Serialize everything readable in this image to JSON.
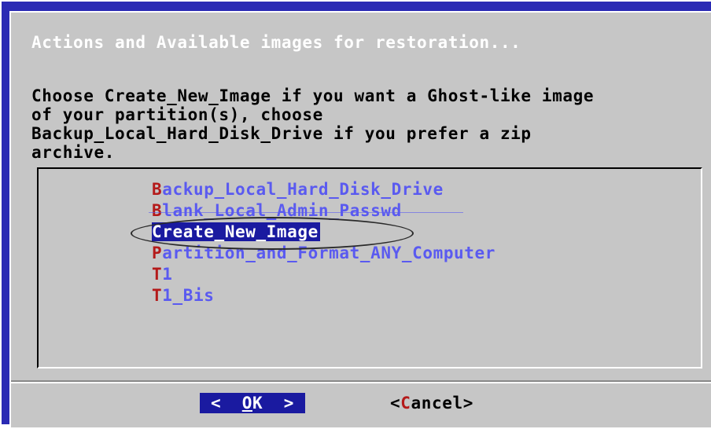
{
  "dialog": {
    "title": "Actions and Available images for restoration...",
    "message_lines": [
      "Choose Create_New_Image if you want a Ghost-like image",
      "of your partition(s), choose",
      "Backup_Local_Hard_Disk_Drive if you prefer a zip",
      "archive."
    ]
  },
  "menu": {
    "selected_index": 2,
    "items": [
      {
        "hotkey": "B",
        "rest": "ackup_Local_Hard_Disk_Drive"
      },
      {
        "hotkey": "B",
        "rest": "lank_Local_Admin_Passwd"
      },
      {
        "hotkey": "C",
        "rest": "reate_New_Image"
      },
      {
        "hotkey": "P",
        "rest": "artition_and_Format_ANY_Computer"
      },
      {
        "hotkey": "T",
        "rest": "1"
      },
      {
        "hotkey": "T",
        "rest": "1_Bis"
      }
    ]
  },
  "buttons": {
    "ok": {
      "left": "<  ",
      "hotkey": "O",
      "rest": "K",
      "right": "  >"
    },
    "cancel": {
      "left": "<",
      "hotkey": "C",
      "rest": "ancel",
      "right": ">"
    }
  },
  "colors": {
    "frame": "#2a2ab4",
    "dialog_bg": "#c6c6c6",
    "item_text": "#5a5af0",
    "hotkey": "#b41a1a",
    "selection": "#1a1aa0"
  }
}
